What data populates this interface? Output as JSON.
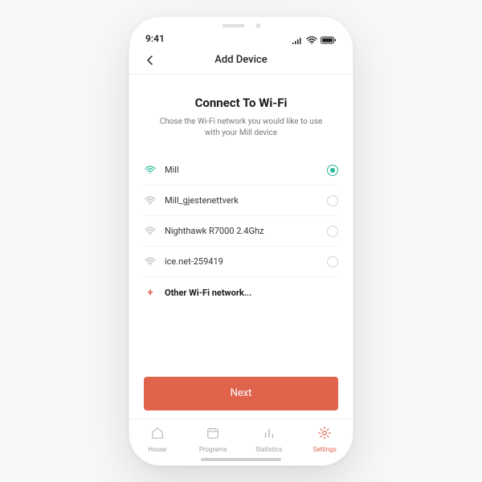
{
  "statusbar": {
    "time": "9:41"
  },
  "navbar": {
    "title": "Add Device"
  },
  "heading": "Connect To Wi-Fi",
  "subheading": "Chose the Wi-Fi network you would like   to use with your Mill device",
  "networks": [
    {
      "name": "Mill",
      "selected": true
    },
    {
      "name": "Mill_gjestenettverk",
      "selected": false
    },
    {
      "name": "Nighthawk R7000 2.4Ghz",
      "selected": false
    },
    {
      "name": "ice.net-259419",
      "selected": false
    }
  ],
  "other_label": "Other Wi-Fi network...",
  "next_label": "Next",
  "tabs": [
    {
      "label": "House",
      "active": false
    },
    {
      "label": "Programs",
      "active": false
    },
    {
      "label": "Statistics",
      "active": false
    },
    {
      "label": "Settings",
      "active": true
    }
  ],
  "colors": {
    "accent": "#e0644c",
    "success": "#28b99a"
  }
}
